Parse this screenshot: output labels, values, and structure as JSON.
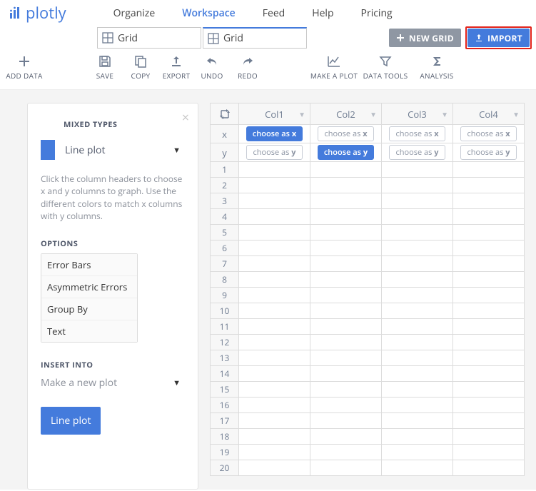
{
  "brand": "plotly",
  "nav": {
    "items": [
      "Organize",
      "Workspace",
      "Feed",
      "Help",
      "Pricing"
    ],
    "activeIndex": 1
  },
  "tabs": [
    {
      "label": "Grid",
      "active": false
    },
    {
      "label": "Grid",
      "active": true
    }
  ],
  "buttons": {
    "newGrid": "NEW GRID",
    "import": "IMPORT"
  },
  "toolbar": {
    "addData": "ADD DATA",
    "save": "SAVE",
    "copy": "COPY",
    "export": "EXPORT",
    "undo": "UNDO",
    "redo": "REDO",
    "makeAPlot": "MAKE A PLOT",
    "dataTools": "DATA TOOLS",
    "analysis": "ANALYSIS"
  },
  "panel": {
    "title": "MIXED TYPES",
    "plotType": "Line plot",
    "helpText": "Click the column headers to choose x and y columns to graph. Use the different colors to match x columns with y columns.",
    "optionsTitle": "OPTIONS",
    "options": [
      "Error Bars",
      "Asymmetric Errors",
      "Group By",
      "Text"
    ],
    "insertTitle": "INSERT INTO",
    "insertValue": "Make a new plot",
    "actionLabel": "Line plot"
  },
  "grid": {
    "columns": [
      "Col1",
      "Col2",
      "Col3",
      "Col4"
    ],
    "axisRows": [
      "x",
      "y"
    ],
    "chips": {
      "x": {
        "label": "choose as",
        "axis": "x",
        "selected": [
          0
        ]
      },
      "y": {
        "label": "choose as",
        "axis": "y",
        "selected": [
          1
        ]
      }
    },
    "rowCount": 20
  }
}
